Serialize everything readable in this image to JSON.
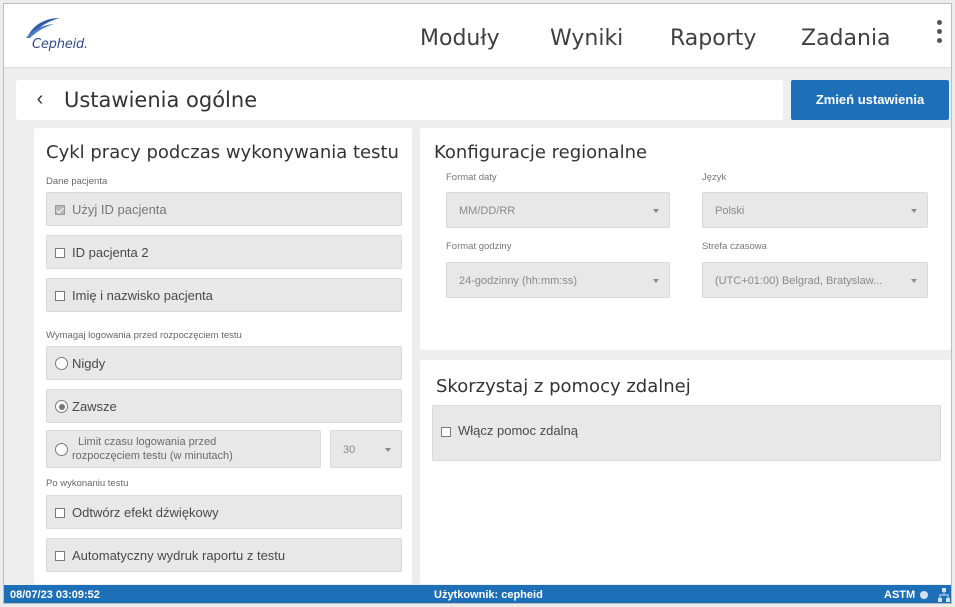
{
  "brand": {
    "logo_text": "Cepheid."
  },
  "nav": {
    "items": [
      {
        "label": "Moduły"
      },
      {
        "label": "Wyniki"
      },
      {
        "label": "Raporty"
      },
      {
        "label": "Zadania"
      }
    ],
    "menu_icon": "kebab-menu-icon"
  },
  "header": {
    "back_icon": "chevron-left-icon",
    "title": "Ustawienia ogólne",
    "action_label": "Zmień ustawienia",
    "accent_color": "#1d6fb8"
  },
  "workflow": {
    "heading": "Cykl pracy podczas wykonywania testu",
    "patient_section": "Dane pacjenta",
    "patient_options": [
      {
        "label": "Użyj ID pacjenta",
        "checked": true
      },
      {
        "label": "ID pacjenta 2",
        "checked": false
      },
      {
        "label": "Imię i nazwisko pacjenta",
        "checked": false
      }
    ],
    "login_section": "Wymagaj logowania przed rozpoczęciem testu",
    "login_options": [
      {
        "label": "Nigdy",
        "selected": false
      },
      {
        "label": "Zawsze",
        "selected": true
      }
    ],
    "login_limit_line1": "Limit czasu logowania przed",
    "login_limit_line2": "rozpoczęciem testu (w minutach)",
    "login_limit_value": "30",
    "after_section": "Po wykonaniu testu",
    "after_options": [
      {
        "label": "Odtwórz efekt dźwiękowy",
        "checked": false
      },
      {
        "label": "Automatyczny wydruk raportu z testu",
        "checked": false
      }
    ]
  },
  "regional": {
    "heading": "Konfiguracje regionalne",
    "date_format_label": "Format daty",
    "date_format_value": "MM/DD/RR",
    "language_label": "Język",
    "language_value": "Polski",
    "time_format_label": "Format godziny",
    "time_format_value": "24-godzinny (hh:mm:ss)",
    "timezone_label": "Strefa czasowa",
    "timezone_value": "(UTC+01:00) Belgrad, Bratyslaw..."
  },
  "remote": {
    "heading": "Skorzystaj z pomocy zdalnej",
    "enable_label": "Włącz pomoc zdalną",
    "enable_checked": false
  },
  "status": {
    "datetime": "08/07/23 03:09:52",
    "user": "Użytkownik: cepheid",
    "protocol": "ASTM"
  }
}
